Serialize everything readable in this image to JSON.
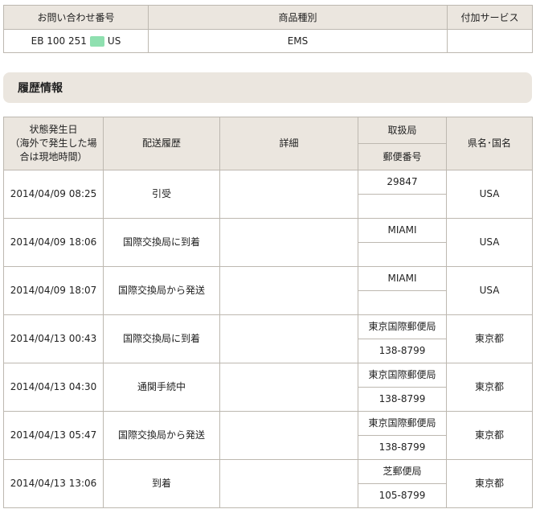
{
  "summary": {
    "headers": [
      "お問い合わせ番号",
      "商品種別",
      "付加サービス"
    ],
    "tracking_prefix": "EB 100 251",
    "tracking_suffix": "US",
    "redaction_color": "#8fe0b0",
    "item_type": "EMS",
    "extra_service": ""
  },
  "history": {
    "section_title": "履歴情報",
    "headers": {
      "date": "状態発生日\n（海外で発生した場合は現地時間）",
      "status": "配送履歴",
      "detail": "詳細",
      "office": "取扱局",
      "postal": "郵便番号",
      "region": "県名･国名"
    },
    "rows": [
      {
        "date": "2014/04/09 08:25",
        "status": "引受",
        "detail": "",
        "office": "29847",
        "postal": "",
        "region": "USA"
      },
      {
        "date": "2014/04/09 18:06",
        "status": "国際交換局に到着",
        "detail": "",
        "office": "MIAMI",
        "postal": "",
        "region": "USA"
      },
      {
        "date": "2014/04/09 18:07",
        "status": "国際交換局から発送",
        "detail": "",
        "office": "MIAMI",
        "postal": "",
        "region": "USA"
      },
      {
        "date": "2014/04/13 00:43",
        "status": "国際交換局に到着",
        "detail": "",
        "office": "東京国際郵便局",
        "postal": "138-8799",
        "region": "東京都"
      },
      {
        "date": "2014/04/13 04:30",
        "status": "通関手続中",
        "detail": "",
        "office": "東京国際郵便局",
        "postal": "138-8799",
        "region": "東京都"
      },
      {
        "date": "2014/04/13 05:47",
        "status": "国際交換局から発送",
        "detail": "",
        "office": "東京国際郵便局",
        "postal": "138-8799",
        "region": "東京都"
      },
      {
        "date": "2014/04/13 13:06",
        "status": "到着",
        "detail": "",
        "office": "芝郵便局",
        "postal": "105-8799",
        "region": "東京都"
      }
    ]
  }
}
